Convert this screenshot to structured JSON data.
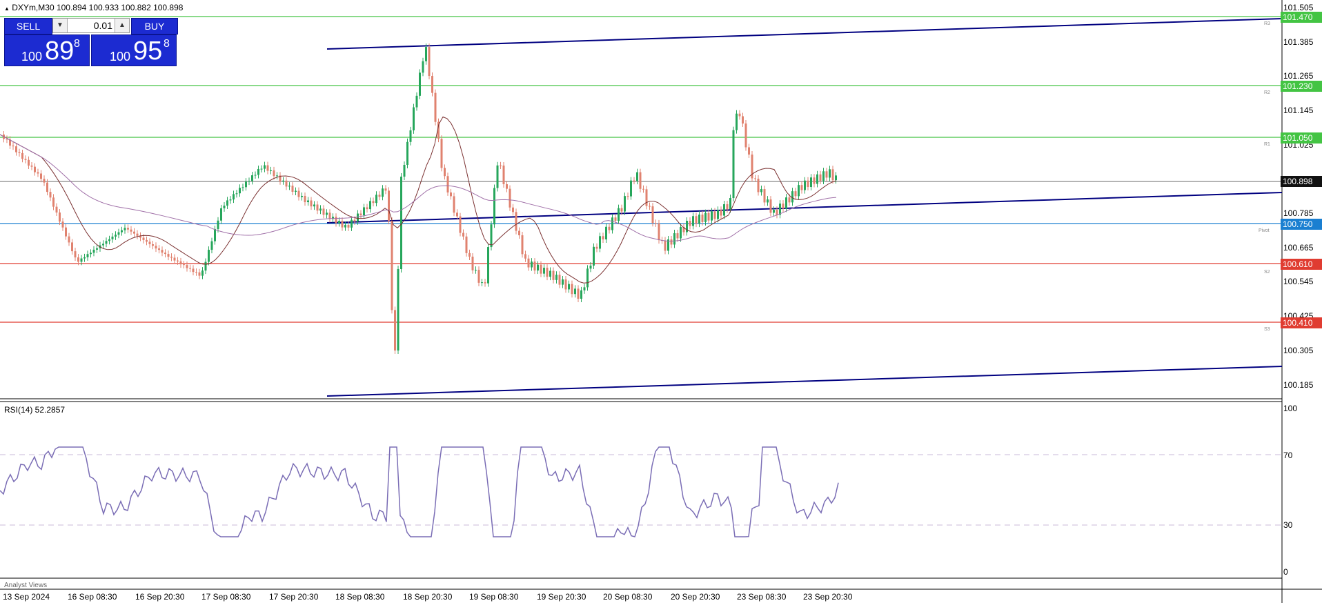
{
  "header": {
    "symbol_info": "DXYm,M30  100.894 100.933 100.882 100.898",
    "rsi_info": "RSI(14) 52.2857"
  },
  "trade_panel": {
    "sell_label": "SELL",
    "buy_label": "BUY",
    "lot_value": "0.01",
    "sell_price": {
      "prefix": "100",
      "big": "89",
      "sup": "8"
    },
    "buy_price": {
      "prefix": "100",
      "big": "95",
      "sup": "8"
    },
    "button_color": "#1c2bd1"
  },
  "price_axis": {
    "ticks": [
      "101.505",
      "101.385",
      "101.265",
      "101.145",
      "101.025",
      "100.785",
      "100.665",
      "100.545",
      "100.425",
      "100.305",
      "100.185"
    ],
    "current_price": "100.898",
    "levels": [
      {
        "value": "101.470",
        "tag": "R3",
        "color": "#43c443"
      },
      {
        "value": "101.230",
        "tag": "R2",
        "color": "#43c443"
      },
      {
        "value": "101.050",
        "tag": "R1",
        "color": "#43c443"
      },
      {
        "value": "100.750",
        "tag": "Pivot",
        "color": "#1a7fd1"
      },
      {
        "value": "100.610",
        "tag": "S2",
        "color": "#e03c31"
      },
      {
        "value": "100.410",
        "tag": "S3",
        "color": "#e03c31"
      }
    ]
  },
  "rsi_axis": {
    "ticks": [
      "100",
      "70",
      "30",
      "0"
    ],
    "line_color": "#7a6db5"
  },
  "time_axis": {
    "labels": [
      "13 Sep 2024",
      "16 Sep 08:30",
      "16 Sep 20:30",
      "17 Sep 08:30",
      "17 Sep 20:30",
      "18 Sep 08:30",
      "18 Sep 20:30",
      "19 Sep 08:30",
      "19 Sep 20:30",
      "20 Sep 08:30",
      "20 Sep 20:30",
      "23 Sep 08:30",
      "23 Sep 20:30"
    ]
  },
  "bottom_tab": "Analyst Views",
  "colors": {
    "bull": "#26a65b",
    "bear": "#e0826f",
    "channel": "#000080"
  }
}
